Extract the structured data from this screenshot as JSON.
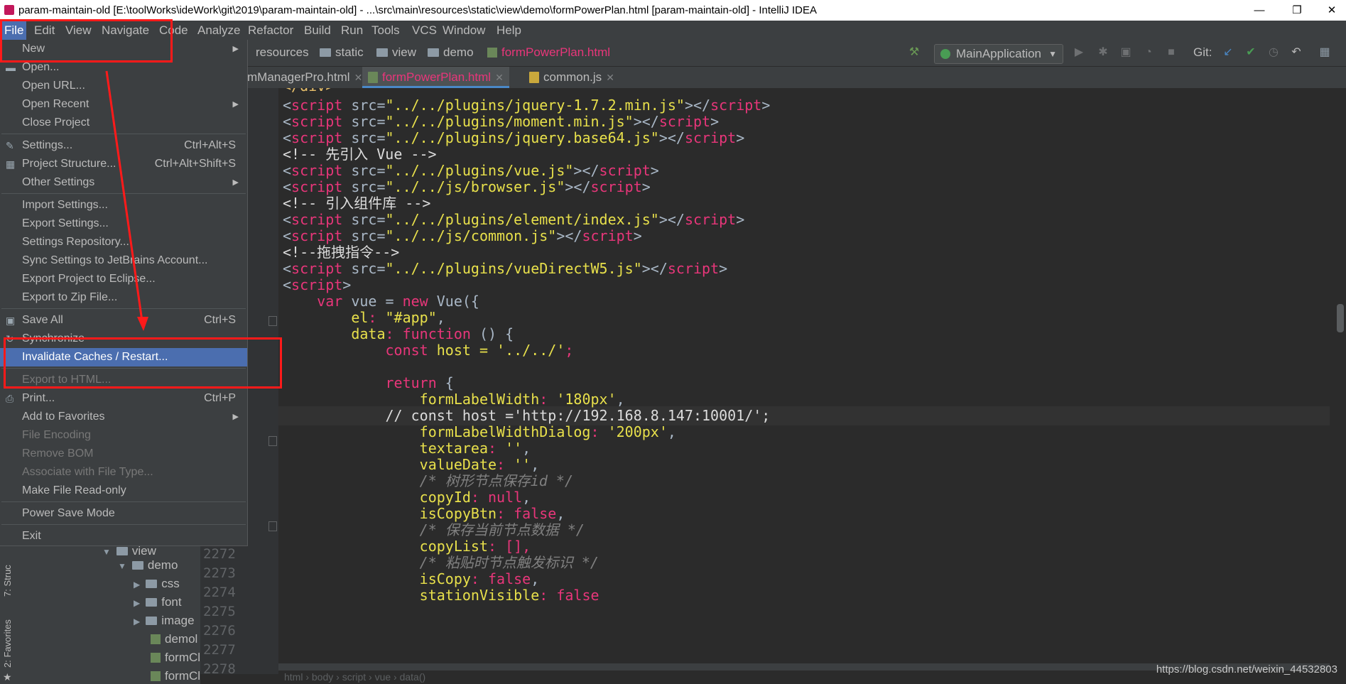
{
  "window": {
    "title": "param-maintain-old [E:\\toolWorks\\ideWork\\git\\2019\\param-maintain-old] - ...\\src\\main\\resources\\static\\view\\demo\\formPowerPlan.html [param-maintain-old] - IntelliJ IDEA",
    "minimize": "—",
    "maximize": "❐",
    "close": "✕"
  },
  "menubar": [
    "File",
    "Edit",
    "View",
    "Navigate",
    "Code",
    "Analyze",
    "Refactor",
    "Build",
    "Run",
    "Tools",
    "VCS",
    "Window",
    "Help"
  ],
  "breadcrumbs": [
    "resources",
    "static",
    "view",
    "demo",
    "formPowerPlan.html"
  ],
  "run_config": "MainApplication",
  "git_label": "Git:",
  "tabs": [
    {
      "label": "mManagerPro.html"
    },
    {
      "label": "formPowerPlan.html"
    },
    {
      "label": "common.js"
    }
  ],
  "file_menu": {
    "new": "New",
    "open": "Open...",
    "open_url": "Open URL...",
    "open_recent": "Open Recent",
    "close_project": "Close Project",
    "settings": "Settings...",
    "settings_sc": "Ctrl+Alt+S",
    "project_structure": "Project Structure...",
    "project_structure_sc": "Ctrl+Alt+Shift+S",
    "other_settings": "Other Settings",
    "import_settings": "Import Settings...",
    "export_settings": "Export Settings...",
    "settings_repository": "Settings Repository...",
    "sync_settings": "Sync Settings to JetBrains Account...",
    "export_eclipse": "Export Project to Eclipse...",
    "export_zip": "Export to Zip File...",
    "save_all": "Save All",
    "save_all_sc": "Ctrl+S",
    "synchronize": "Synchronize",
    "invalidate": "Invalidate Caches / Restart...",
    "export_html": "Export to HTML...",
    "print": "Print...",
    "print_sc": "Ctrl+P",
    "add_favorites": "Add to Favorites",
    "file_encoding": "File Encoding",
    "remove_bom": "Remove BOM",
    "associate": "Associate with File Type...",
    "make_readonly": "Make File Read-only",
    "power_save": "Power Save Mode",
    "exit": "Exit"
  },
  "project_tree": {
    "view": "view",
    "demo": "demo",
    "css": "css",
    "font": "font",
    "image": "image",
    "f1": "demol",
    "f2": "formCl",
    "f3": "formCl"
  },
  "side_tools": {
    "structure": "7: Struc",
    "favorites": "2: Favorites"
  },
  "line_numbers": [
    "2272",
    "2273",
    "2274",
    "2275",
    "2276",
    "2277",
    "2278"
  ],
  "code": {
    "l0": "</div>",
    "l1_src": "\"../../plugins/jquery-1.7.2.min.js\"",
    "l2_src": "\"../../plugins/moment.min.js\"",
    "l3_src": "\"../../plugins/jquery.base64.js\"",
    "l4": "<!-- 先引入 Vue -->",
    "l5_src": "\"../../plugins/vue.js\"",
    "l6_src": "\"../../js/browser.js\"",
    "l7": "<!-- 引入组件库 -->",
    "l8_src": "\"../../plugins/element/index.js\"",
    "l9_src": "\"../../js/common.js\"",
    "l10": "<!--拖拽指令-->",
    "l11_src": "\"../../plugins/vueDirectW5.js\"",
    "l13_a": "var",
    "l13_b": " vue = ",
    "l13_c": "new",
    "l13_d": " Vue({",
    "l14_a": "el",
    "l14_b": ": ",
    "l14_c": "\"#app\"",
    "l14_d": ",",
    "l15_a": "data",
    "l15_b": ": ",
    "l15_c": "function",
    "l15_d": " () {",
    "l16_a": "const",
    "l16_b": " host = ",
    "l16_c": "'../../'",
    "l16_d": ";",
    "l17": "// const host ='http://192.168.8.147:10001/';",
    "l18_a": "return",
    "l18_b": " {",
    "l19_a": "formLabelWidth",
    "l19_b": ": ",
    "l19_c": "'180px'",
    "l19_d": ",",
    "l20_a": "formLabelWidthDialog",
    "l20_b": ": ",
    "l20_c": "'200px'",
    "l20_d": ",",
    "l21_a": "textarea",
    "l21_b": ": ",
    "l21_c": "''",
    "l21_d": ",",
    "l22_a": "valueDate",
    "l22_b": ": ",
    "l22_c": "''",
    "l22_d": ",",
    "l23": "/* 树形节点保存id */",
    "l24_a": "copyId",
    "l24_b": ": ",
    "l24_c": "null",
    "l24_d": ",",
    "l25_a": "isCopyBtn",
    "l25_b": ": ",
    "l25_c": "false",
    "l25_d": ",",
    "l26": "/* 保存当前节点数据 */",
    "l27_a": "copyList",
    "l27_b": ": [],",
    "l28": "/* 粘贴时节点触发标识 */",
    "l29_a": "isCopy",
    "l29_b": ": ",
    "l29_c": "false",
    "l29_d": ",",
    "l30_a": "stationVisible",
    "l30_b": ": ",
    "l30_c": "false",
    "script_kw": "script",
    "src_attr": " src=",
    "open_lt": "<",
    "close_gt": "></",
    "end_gt": ">"
  },
  "bottom_crumbs": "html  ›  body  ›  script  ›  vue  ›  data()",
  "watermark": "https://blog.csdn.net/weixin_44532803",
  "colors": {
    "accent": "#4b6eaf",
    "annotation": "#ff1a1a"
  }
}
